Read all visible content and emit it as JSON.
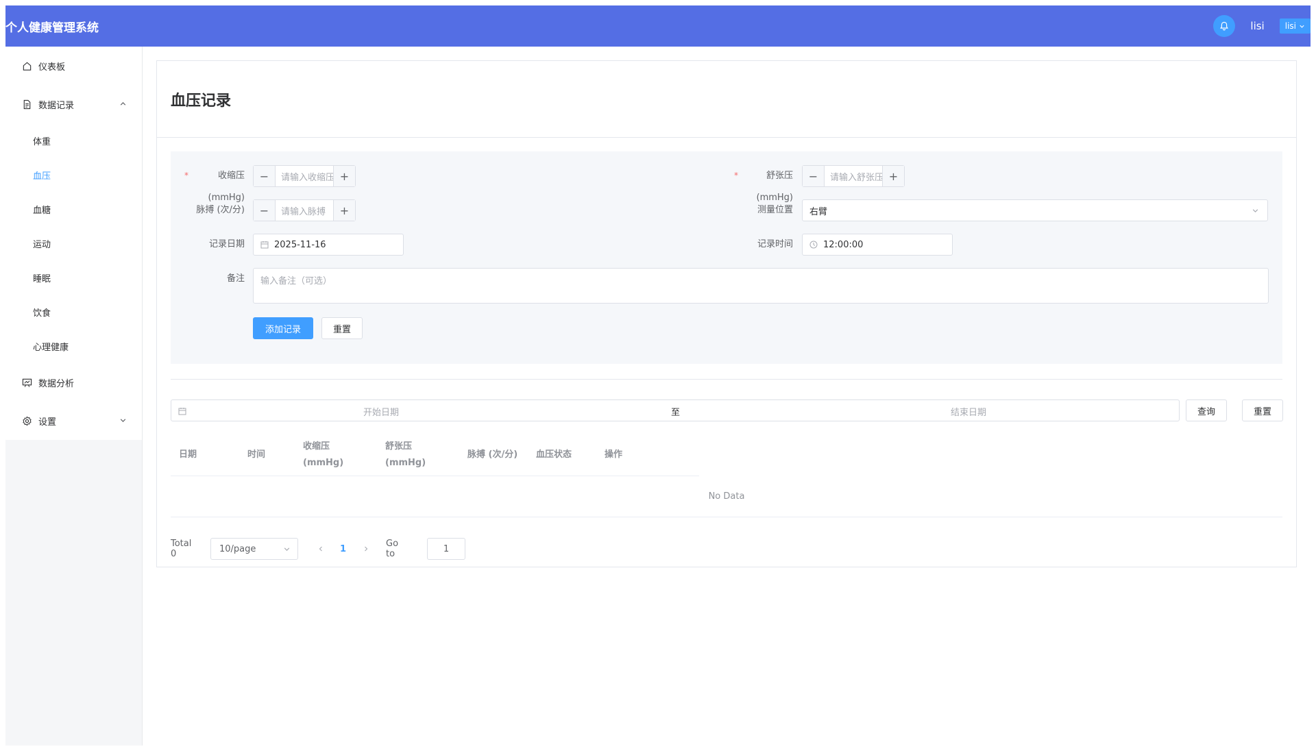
{
  "header": {
    "title": "个人健康管理系统",
    "username": "lisi",
    "user_btn": "lisi"
  },
  "sidebar": {
    "dashboard": "仪表板",
    "records": "数据记录",
    "sub_items": [
      "体重",
      "血压",
      "血糖",
      "运动",
      "睡眠",
      "饮食",
      "心理健康"
    ],
    "analysis": "数据分析",
    "settings": "设置"
  },
  "page": {
    "title": "血压记录"
  },
  "form": {
    "systolic_label": "收缩压",
    "systolic_unit": "(mmHg)",
    "systolic_placeholder": "请输入收缩压",
    "diastolic_label": "舒张压",
    "diastolic_unit": "(mmHg)",
    "diastolic_placeholder": "请输入舒张压",
    "pulse_label": "脉搏 (次/分)",
    "pulse_placeholder": "请输入脉搏",
    "position_label": "测量位置",
    "position_value": "右臂",
    "date_label": "记录日期",
    "date_value": "2025-11-16",
    "time_label": "记录时间",
    "time_value": "12:00:00",
    "note_label": "备注",
    "note_placeholder": "输入备注（可选）",
    "add_btn": "添加记录",
    "reset_btn": "重置"
  },
  "filter": {
    "start": "开始日期",
    "sep": "至",
    "end": "结束日期",
    "query_btn": "查询",
    "reset_btn": "重置"
  },
  "table": {
    "columns": [
      "日期",
      "时间",
      "收缩压",
      "(mmHg)",
      "舒张压",
      "(mmHg)",
      "脉搏 (次/分)",
      "血压状态",
      "操作"
    ],
    "empty": "No Data"
  },
  "pagination": {
    "total": "Total 0",
    "page_size": "10/page",
    "current": "1",
    "goto": "Go to",
    "goto_value": "1"
  },
  "colors": {
    "header": "#546ee4",
    "accent": "#409eff",
    "required": "#f56c6c"
  }
}
